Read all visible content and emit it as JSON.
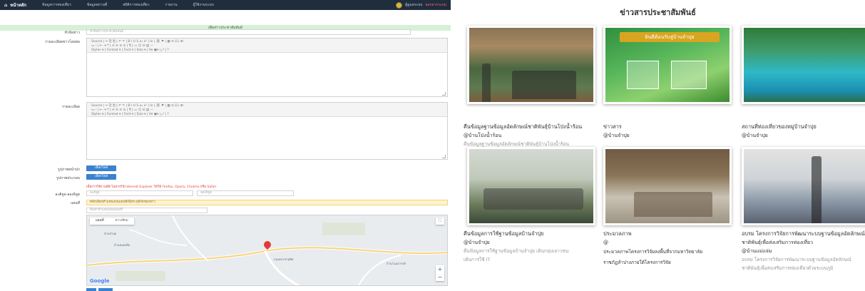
{
  "admin": {
    "nav": {
      "brand": "หน้าหลัก",
      "items": [
        "ข้อมูลการท่องเที่ยว",
        "ข้อมูลสถานที่",
        "สถิติการท่องเที่ยว",
        "รายงาน",
        "ผู้ใช้งานระบบ"
      ],
      "user": "ผู้ดูแลระบบ",
      "logout": "ออกจากระบบ"
    },
    "page_header": "เพิ่มข่าวประชาสัมพันธ์",
    "fields": {
      "title_label": "หัวข้อข่าว",
      "title_placeholder": "หัวข้อข่าวประชาสัมพันธ์",
      "summary_label": "รายละเอียดข่าวโดยย่อ",
      "detail_label": "รายละเอียด",
      "cover_label": "รูปภาพหน้าปก",
      "gallery_label": "รูปภาพประกอบ",
      "upload_label": "เลือกไฟล์",
      "browser_warning": "เพื่อการใช้งานที่ดี ไม่ควรใช้ Internet Explorer ให้ใช้ Firefox, Opera, Chrome หรือ Safari",
      "latlng_label": "ละติจูด-ลองจิจูด",
      "lat_placeholder": "ละติจูด",
      "lng_placeholder": "ลองจิจูด",
      "map_label": "แผนที่",
      "map_alert": "คลิกเลือกตำแหน่งบนแผนที่เพื่อระบุพิกัดของข่าว",
      "map_search_placeholder": "ค้นหาตำแหน่งบนแผนที่"
    },
    "editor_toolbar": {
      "row1": "Source | ✂ ⎘ ⎗ | ↶ ↷ | B I U S x₂ x² | Ix | ⛓ ⚑ | ▦ ≡ Ω | ⊞",
      "row2": "≔ ⁝ | ⇤ ⇥ ❝ | ≡ ≡ ≡ ≡ | ¶ | ▭ ☺ ⊡ ▤ —",
      "row3": "Styles ▾ | Format ▾ | Font ▾ | Size ▾ | A▾ ▣▾ | ⤢ | ?"
    },
    "map": {
      "tab_map": "แผนที่",
      "tab_satellite": "ดาวเทียม",
      "logo": "Google",
      "labels": [
        "บ้านจำปุย",
        "บ้านหนองผือ",
        "ถนนประชาอุทิศ",
        "บ้านโนนสวรรค์"
      ],
      "pin_icon": "map-pin-icon"
    }
  },
  "news": {
    "title": "ข่าวสารประชาสัมพันธ์",
    "cards": [
      {
        "title": "คืนข้อมูลฐานข้อมูลอัตลักษณ์ชาติพันธุ์บ้านโป่งน้ำร้อน",
        "category": "@บ้านโป่งน้ำร้อน",
        "desc": "คืนข้อมูลฐานข้อมูลอัตลักษณ์ชาติพันธุ์บ้านโป่งน้ำร้อน",
        "desc2": ""
      },
      {
        "title": "ข่าวสาร",
        "category": "@บ้านจำปุย",
        "desc": "",
        "desc2": "",
        "banner": "ยินดีต้อนรับสู่บ้านจำปุย"
      },
      {
        "title": "สถานที่ท่องเที่ยวของหมู่บ้านจำปุย",
        "category": "@บ้านจำปุย",
        "desc": "",
        "desc2": ""
      },
      {
        "title": "คืนข้อมูลการใช้ฐานข้อมูลบ้านจำปุย",
        "category": "@บ้านจำปุย",
        "desc": "คืนข้อมูลการใช้ฐานข้อมูลบ้านจำปุย เดินกลุ่มเยาวชน",
        "desc2": "เดินการใช้ IT"
      },
      {
        "title": "ประมวลภาพ",
        "category": "@",
        "desc": "ประมวลภาพโครงการวิจัยลงพื้นที่จากมหาวิทยาลัย",
        "desc2": "ราชภัฏลำปางภายใต้โครงการวิจัย"
      },
      {
        "title": "อบรม โครงการวิจัยการพัฒนาระบบฐานข้อมูลอัตลักษณ์",
        "category": "ชาติพันธุ์เพื่อส่งเสริมการท่องเที่ยว",
        "category2": "@บ้านแม่แจ่ม",
        "desc": "อบรม โครงการวิจัยการพัฒนาระบบฐานข้อมูลอัตลักษณ์",
        "desc2": "ชาติพันธุ์เพื่อส่งเสริมการท่องเที่ยวด้วยระบบภูมิ"
      }
    ]
  }
}
